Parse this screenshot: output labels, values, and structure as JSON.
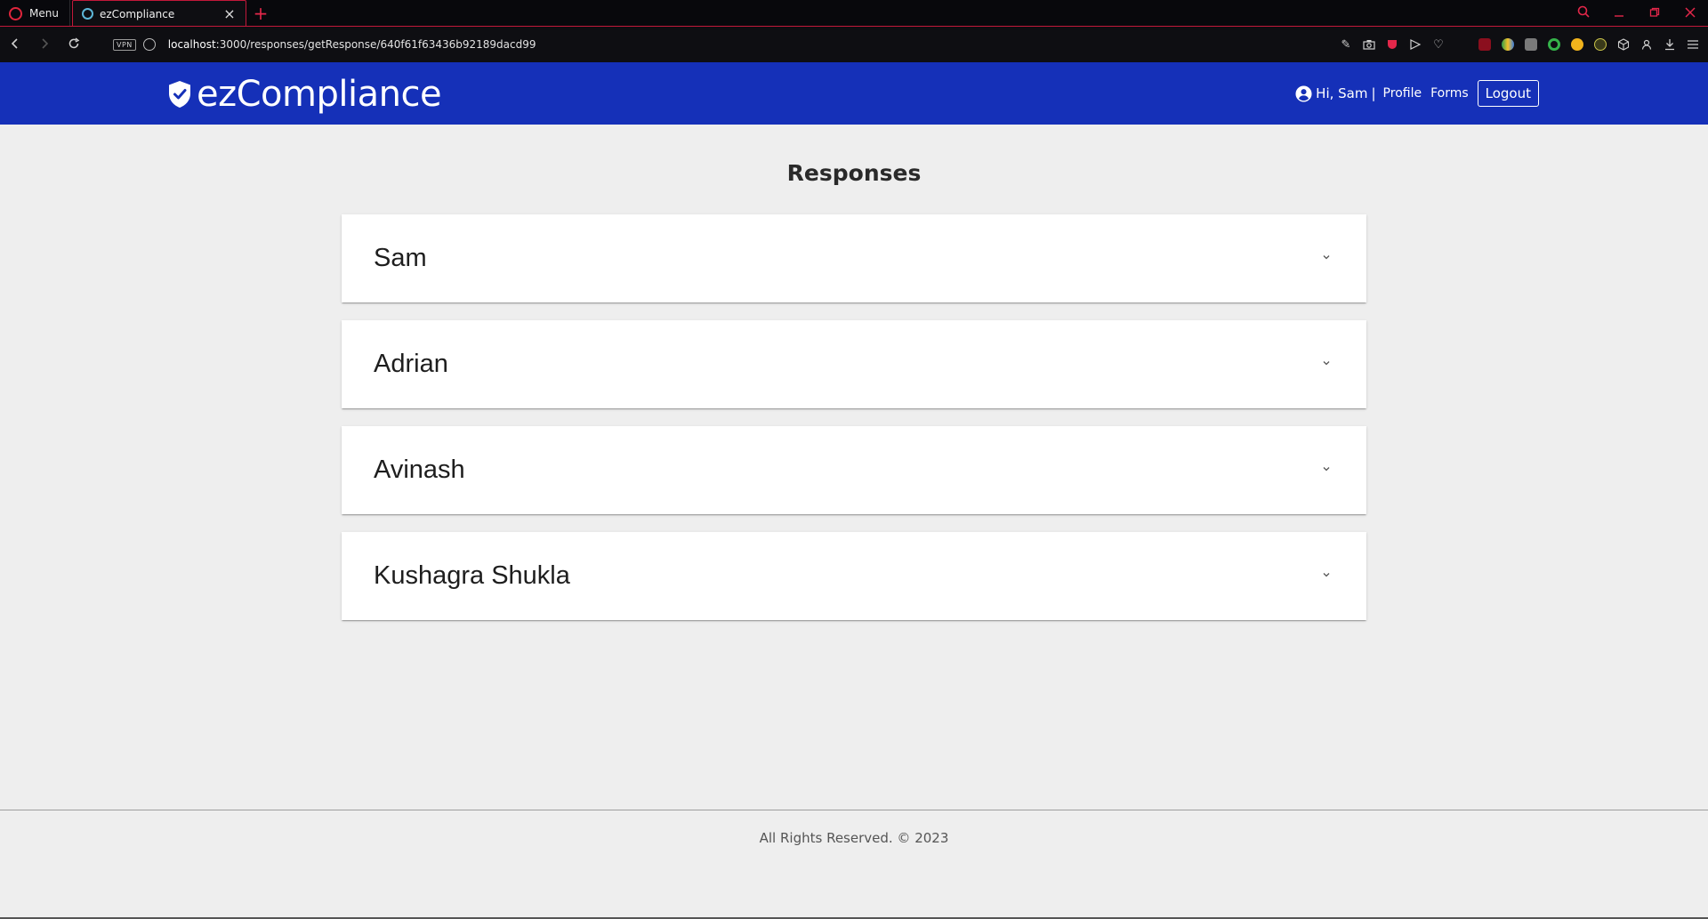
{
  "browser": {
    "menu_label": "Menu",
    "tab_title": "ezCompliance",
    "url_host": "localhost",
    "url_rest": ":3000/responses/getResponse/640f61f63436b92189dacd99",
    "vpn_label": "VPN"
  },
  "header": {
    "brand": "ezCompliance",
    "greeting": "Hi, Sam",
    "separator": "|",
    "profile_label": "Profile",
    "forms_label": "Forms",
    "logout_label": "Logout"
  },
  "main": {
    "title": "Responses",
    "responses": [
      {
        "name": "Sam"
      },
      {
        "name": "Adrian"
      },
      {
        "name": "Avinash"
      },
      {
        "name": "Kushagra Shukla"
      }
    ]
  },
  "footer": {
    "text": "All Rights Reserved. © 2023"
  },
  "colors": {
    "header_bg": "#1530b8",
    "page_bg": "#eeeeee",
    "browser_accent": "#e3274a"
  },
  "icons": {
    "brand": "shield-check-icon",
    "user": "account-circle-icon",
    "expand": "chevron-down-icon"
  }
}
